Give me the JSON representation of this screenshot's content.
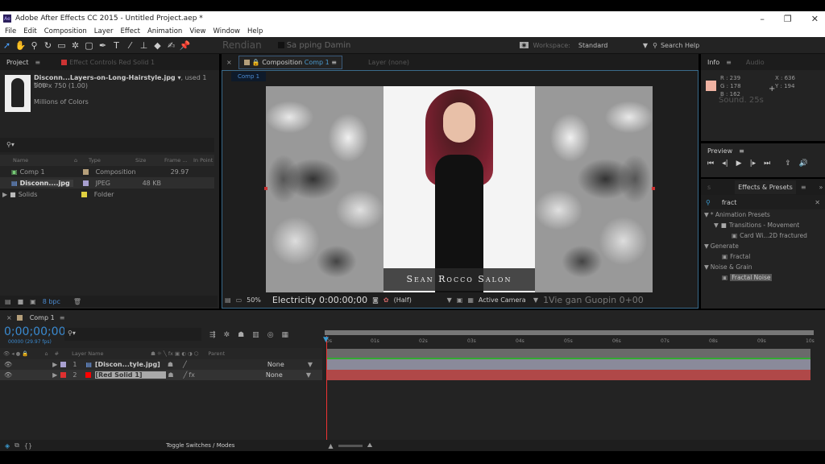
{
  "window": {
    "title": "Adobe After Effects CC 2015 - Untitled Project.aep *",
    "app_icon": "Ae"
  },
  "menu": [
    "File",
    "Edit",
    "Composition",
    "Layer",
    "Effect",
    "Animation",
    "View",
    "Window",
    "Help"
  ],
  "toolbar": {
    "overlay_text_1": "Rendian",
    "overlay_text_2": "Sa pping Damin",
    "workspace_label": "Workspace:",
    "workspace_value": "Standard",
    "search_help": "Search Help"
  },
  "project": {
    "tab": "Project",
    "effect_controls_tab": "Effect Controls Red Solid 1",
    "file_name": "Disconn...Layers-on-Long-Hairstyle.jpg",
    "used": ", used 1 time",
    "dimensions": "500 x 750 (1.00)",
    "colors": "Millions of Colors",
    "columns": [
      "Name",
      "Type",
      "Size",
      "Frame ...",
      "In Point"
    ],
    "items": [
      {
        "name": "Comp 1",
        "type": "Composition",
        "size": "",
        "frame": "29.97",
        "color": "#b59f7a"
      },
      {
        "name": "Disconn....jpg",
        "type": "JPEG",
        "size": "48 KB",
        "frame": "",
        "color": "#a8a0d0"
      },
      {
        "name": "Solids",
        "type": "Folder",
        "size": "",
        "frame": "",
        "color": "#e0d040"
      }
    ],
    "bpc": "8 bpc"
  },
  "composition": {
    "tab_label": "Composition",
    "comp_name": "Comp 1",
    "layer_tab": "Layer (none)",
    "inner_tab": "Comp 1",
    "watermark": "Sean Rocco Salon",
    "zoom": "50%",
    "overlay_time": "Electricity 0:00:00;00",
    "resolution": "(Half)",
    "camera": "Active Camera",
    "overlay_right": "1Vie gan Guopin 0+00"
  },
  "info": {
    "tab": "Info",
    "audio_tab": "Audio",
    "swatch": "#efb2a2",
    "r": "R : 239",
    "g": "G : 178",
    "b": "B : 162",
    "x": "X : 636",
    "y": "Y : 194",
    "overlay": "Sound. 25s"
  },
  "preview": {
    "tab": "Preview"
  },
  "effects": {
    "tab": "Effects & Presets",
    "search": "fract",
    "tree": [
      {
        "label": "* Animation Presets",
        "level": 0,
        "arrow": "▼"
      },
      {
        "label": "Transitions - Movement",
        "level": 1,
        "arrow": "▼"
      },
      {
        "label": "Card Wi...2D fractured",
        "level": 2,
        "arrow": ""
      },
      {
        "label": "Generate",
        "level": 0,
        "arrow": "▼"
      },
      {
        "label": "Fractal",
        "level": 1,
        "arrow": ""
      },
      {
        "label": "Noise & Grain",
        "level": 0,
        "arrow": "▼"
      },
      {
        "label": "Fractal Noise",
        "level": 1,
        "arrow": "",
        "selected": true
      }
    ]
  },
  "timeline": {
    "tab": "Comp 1",
    "timecode": "0;00;00;00",
    "fps": "00000 (29.97 fps)",
    "columns": {
      "num": "#",
      "layer_name": "Layer Name",
      "parent": "Parent"
    },
    "ruler": [
      "0s",
      "01s",
      "02s",
      "03s",
      "04s",
      "05s",
      "06s",
      "07s",
      "08s",
      "09s",
      "10s"
    ],
    "layers": [
      {
        "num": "1",
        "name": "[Discon...tyle.jpg]",
        "color": "#a8a0d0",
        "parent": "None",
        "fx": false,
        "bar": "#8a8a9a"
      },
      {
        "num": "2",
        "name": "[Red Solid 1]",
        "color": "#e03030",
        "parent": "None",
        "fx": true,
        "bar": "#b04848"
      }
    ],
    "toggle": "Toggle Switches / Modes"
  }
}
